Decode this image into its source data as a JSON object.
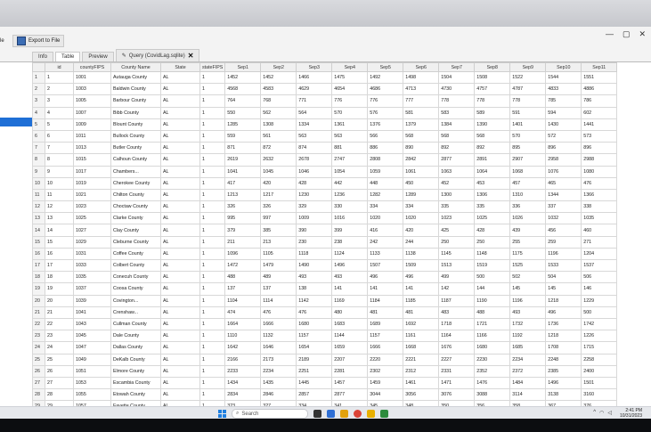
{
  "window": {
    "export_label": "Export to File",
    "controls": [
      "—",
      "▢",
      "✕"
    ]
  },
  "tabs": [
    {
      "label": "Info"
    },
    {
      "label": "Table"
    },
    {
      "label": "Preview"
    },
    {
      "label": "Query (CovidLag.sqlite)"
    }
  ],
  "grid": {
    "columns": [
      "",
      "id",
      "countyFIPS",
      "County Name",
      "State",
      "stateFIPS",
      "Sep1",
      "Sep2",
      "Sep3",
      "Sep4",
      "Sep5",
      "Sep6",
      "Sep7",
      "Sep8",
      "Sep9",
      "Sep10",
      "Sep11"
    ],
    "rows": [
      [
        "1",
        "1",
        "1001",
        "Autauga County",
        "AL",
        "1",
        "1452",
        "1452",
        "1466",
        "1475",
        "1492",
        "1498",
        "1504",
        "1508",
        "1522",
        "1544",
        "1551"
      ],
      [
        "2",
        "2",
        "1003",
        "Baldwin County",
        "AL",
        "1",
        "4568",
        "4583",
        "4629",
        "4654",
        "4686",
        "4713",
        "4730",
        "4757",
        "4787",
        "4833",
        "4886"
      ],
      [
        "3",
        "3",
        "1005",
        "Barbour County",
        "AL",
        "1",
        "764",
        "768",
        "771",
        "776",
        "776",
        "777",
        "778",
        "778",
        "778",
        "785",
        "786"
      ],
      [
        "4",
        "4",
        "1007",
        "Bibb County",
        "AL",
        "1",
        "550",
        "562",
        "564",
        "570",
        "576",
        "581",
        "583",
        "589",
        "591",
        "594",
        "602"
      ],
      [
        "5",
        "5",
        "1009",
        "Blount County",
        "AL",
        "1",
        "1285",
        "1308",
        "1334",
        "1361",
        "1376",
        "1379",
        "1384",
        "1390",
        "1401",
        "1430",
        "1441"
      ],
      [
        "6",
        "6",
        "1011",
        "Bullock County",
        "AL",
        "1",
        "559",
        "561",
        "563",
        "563",
        "566",
        "568",
        "568",
        "568",
        "570",
        "572",
        "573"
      ],
      [
        "7",
        "7",
        "1013",
        "Butler County",
        "AL",
        "1",
        "871",
        "872",
        "874",
        "881",
        "886",
        "890",
        "892",
        "892",
        "895",
        "896",
        "896"
      ],
      [
        "8",
        "8",
        "1015",
        "Calhoun County",
        "AL",
        "1",
        "2619",
        "2632",
        "2678",
        "2747",
        "2808",
        "2842",
        "2877",
        "2891",
        "2907",
        "2958",
        "2988"
      ],
      [
        "9",
        "9",
        "1017",
        "Chambers...",
        "AL",
        "1",
        "1041",
        "1045",
        "1046",
        "1054",
        "1059",
        "1061",
        "1063",
        "1064",
        "1068",
        "1076",
        "1080"
      ],
      [
        "10",
        "10",
        "1019",
        "Cherokee County",
        "AL",
        "1",
        "417",
        "420",
        "428",
        "442",
        "448",
        "450",
        "452",
        "453",
        "457",
        "465",
        "476"
      ],
      [
        "11",
        "11",
        "1021",
        "Chilton County",
        "AL",
        "1",
        "1213",
        "1217",
        "1230",
        "1236",
        "1282",
        "1289",
        "1300",
        "1306",
        "1310",
        "1344",
        "1366"
      ],
      [
        "12",
        "12",
        "1023",
        "Choctaw County",
        "AL",
        "1",
        "326",
        "326",
        "329",
        "330",
        "334",
        "334",
        "335",
        "335",
        "336",
        "337",
        "338"
      ],
      [
        "13",
        "13",
        "1025",
        "Clarke County",
        "AL",
        "1",
        "995",
        "997",
        "1009",
        "1016",
        "1020",
        "1020",
        "1023",
        "1025",
        "1026",
        "1032",
        "1035"
      ],
      [
        "14",
        "14",
        "1027",
        "Clay County",
        "AL",
        "1",
        "379",
        "385",
        "390",
        "399",
        "416",
        "420",
        "425",
        "428",
        "439",
        "456",
        "460"
      ],
      [
        "15",
        "15",
        "1029",
        "Cleburne County",
        "AL",
        "1",
        "211",
        "213",
        "230",
        "238",
        "242",
        "244",
        "250",
        "250",
        "255",
        "259",
        "271"
      ],
      [
        "16",
        "16",
        "1031",
        "Coffee County",
        "AL",
        "1",
        "1096",
        "1105",
        "1118",
        "1124",
        "1133",
        "1138",
        "1145",
        "1148",
        "1175",
        "1196",
        "1204"
      ],
      [
        "17",
        "17",
        "1033",
        "Colbert County",
        "AL",
        "1",
        "1472",
        "1479",
        "1490",
        "1496",
        "1507",
        "1509",
        "1513",
        "1519",
        "1525",
        "1533",
        "1537"
      ],
      [
        "18",
        "18",
        "1035",
        "Conecuh County",
        "AL",
        "1",
        "488",
        "489",
        "493",
        "493",
        "496",
        "496",
        "499",
        "500",
        "502",
        "504",
        "506"
      ],
      [
        "19",
        "19",
        "1037",
        "Coosa County",
        "AL",
        "1",
        "137",
        "137",
        "138",
        "141",
        "141",
        "141",
        "142",
        "144",
        "145",
        "145",
        "146"
      ],
      [
        "20",
        "20",
        "1039",
        "Covington...",
        "AL",
        "1",
        "1104",
        "1114",
        "1142",
        "1169",
        "1184",
        "1185",
        "1187",
        "1190",
        "1196",
        "1218",
        "1229"
      ],
      [
        "21",
        "21",
        "1041",
        "Crenshaw...",
        "AL",
        "1",
        "474",
        "476",
        "476",
        "480",
        "481",
        "481",
        "483",
        "488",
        "493",
        "496",
        "500"
      ],
      [
        "22",
        "22",
        "1043",
        "Cullman County",
        "AL",
        "1",
        "1664",
        "1666",
        "1680",
        "1683",
        "1689",
        "1692",
        "1718",
        "1721",
        "1732",
        "1736",
        "1742"
      ],
      [
        "23",
        "23",
        "1045",
        "Dale County",
        "AL",
        "1",
        "1110",
        "1132",
        "1157",
        "1144",
        "1157",
        "1161",
        "1164",
        "1166",
        "1192",
        "1218",
        "1226"
      ],
      [
        "24",
        "24",
        "1047",
        "Dallas County",
        "AL",
        "1",
        "1642",
        "1646",
        "1654",
        "1659",
        "1666",
        "1668",
        "1676",
        "1680",
        "1685",
        "1708",
        "1715"
      ],
      [
        "25",
        "25",
        "1049",
        "DeKalb County",
        "AL",
        "1",
        "2166",
        "2173",
        "2189",
        "2207",
        "2220",
        "2221",
        "2227",
        "2230",
        "2234",
        "2248",
        "2258"
      ],
      [
        "26",
        "26",
        "1051",
        "Elmore County",
        "AL",
        "1",
        "2233",
        "2234",
        "2251",
        "2281",
        "2302",
        "2312",
        "2331",
        "2352",
        "2372",
        "2385",
        "2400"
      ],
      [
        "27",
        "27",
        "1053",
        "Escambia County",
        "AL",
        "1",
        "1434",
        "1435",
        "1445",
        "1457",
        "1459",
        "1461",
        "1471",
        "1476",
        "1484",
        "1496",
        "1501"
      ],
      [
        "28",
        "28",
        "1055",
        "Etowah County",
        "AL",
        "1",
        "2834",
        "2846",
        "2857",
        "2877",
        "3044",
        "3056",
        "3076",
        "3088",
        "3114",
        "3138",
        "3160"
      ],
      [
        "29",
        "29",
        "1057",
        "Fayette County",
        "AL",
        "1",
        "323",
        "327",
        "334",
        "341",
        "345",
        "348",
        "350",
        "356",
        "358",
        "367",
        "376"
      ]
    ]
  },
  "taskbar": {
    "search_placeholder": "Search",
    "time": "2:41 PM",
    "date": "10/31/2023"
  }
}
